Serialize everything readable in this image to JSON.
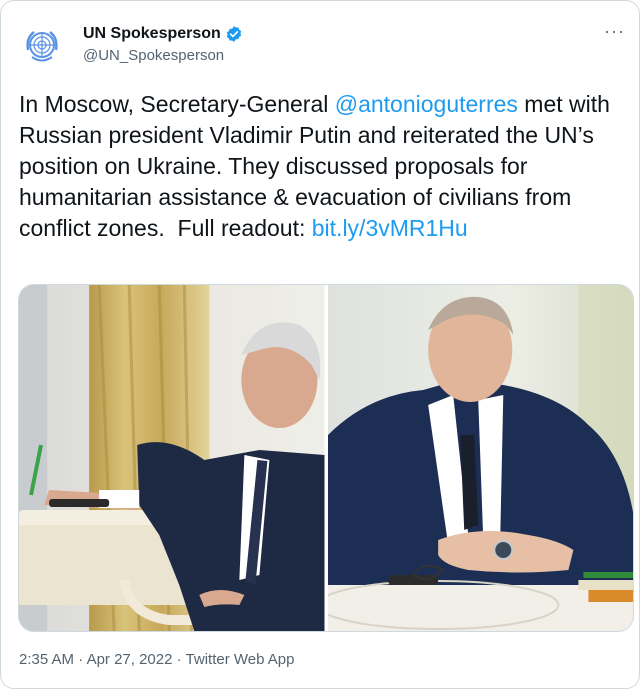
{
  "account": {
    "display_name": "UN Spokesperson",
    "handle": "@UN_Spokesperson",
    "verified": true,
    "avatar_icon": "un-emblem-icon",
    "verified_icon": "verified-badge-icon"
  },
  "menu": {
    "more_label": "···"
  },
  "tweet": {
    "text_1": "In Moscow, Secretary-General ",
    "mention": "@antonioguterres",
    "text_2": " met with Russian president Vladimir Putin and reiterated the UN’s position on Ukraine. They discussed proposals for humanitarian assistance & evacuation of civilians from conflict zones.  Full readout: ",
    "url": "bit.ly/3vMR1Hu"
  },
  "media": {
    "photos": [
      {
        "icon": "photo-guterres"
      },
      {
        "icon": "photo-putin"
      }
    ]
  },
  "meta": {
    "time": "2:35 AM",
    "sep1": " · ",
    "date": "Apr 27, 2022",
    "sep2": " · ",
    "source": "Twitter Web App"
  },
  "colors": {
    "link": "#1d9bf0",
    "verified": "#1d9bf0",
    "un_blue": "#5b92e5",
    "secondary_text": "#536471"
  }
}
